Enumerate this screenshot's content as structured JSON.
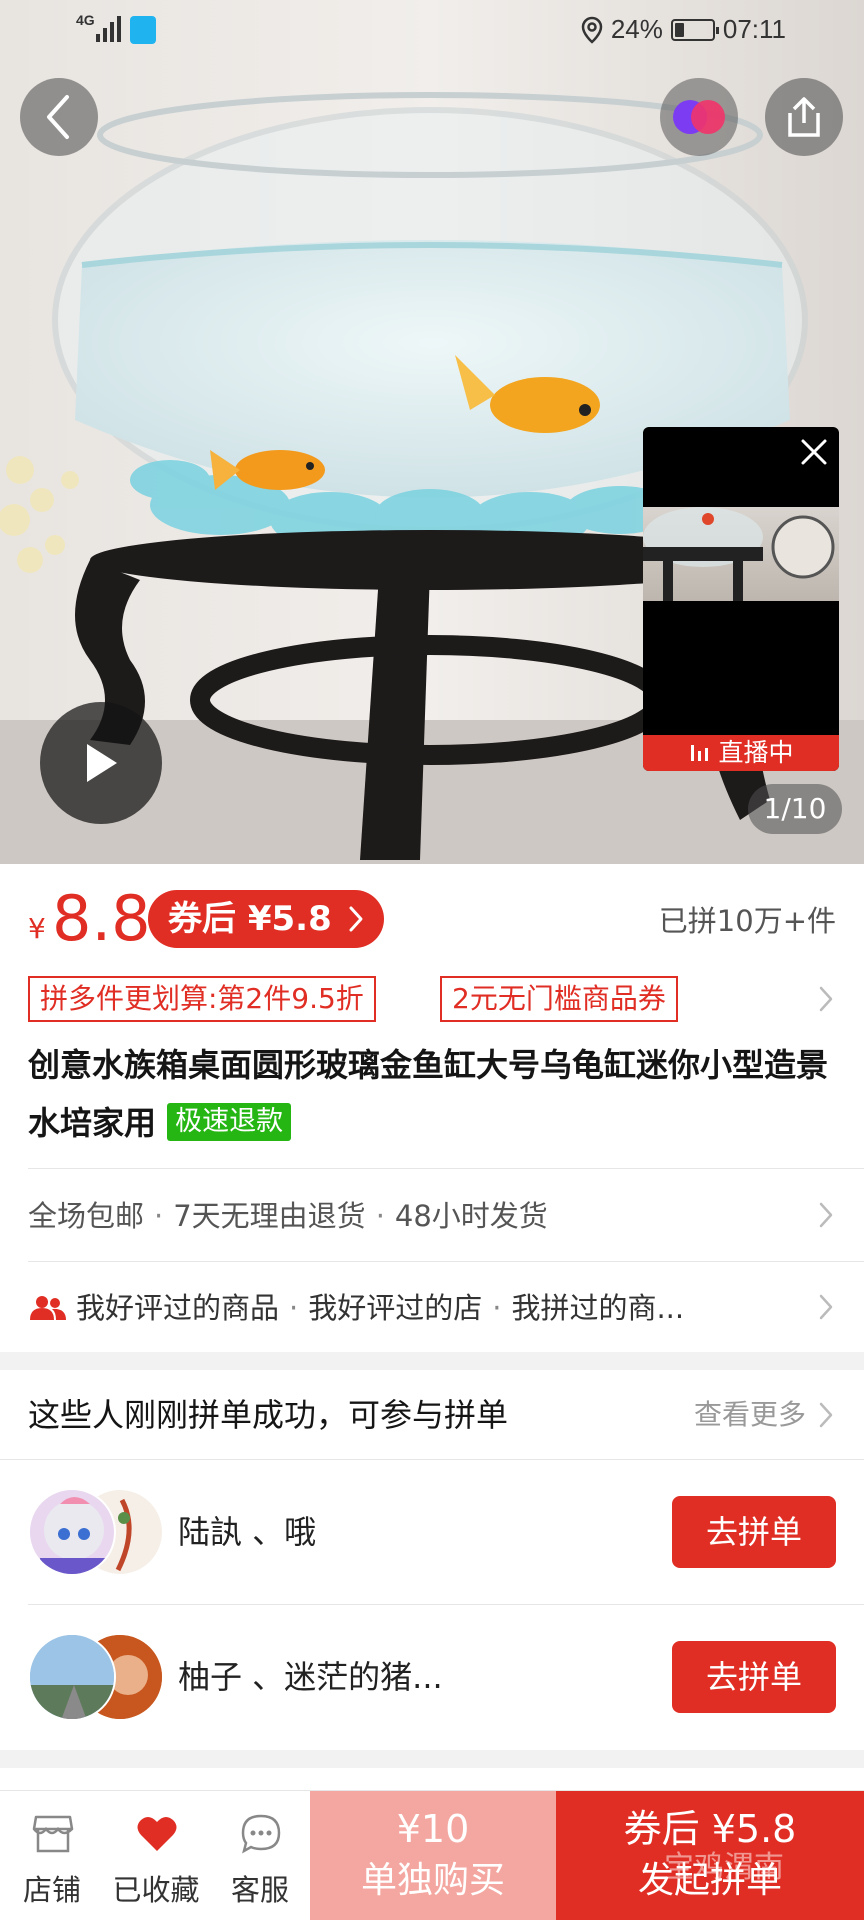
{
  "status_bar": {
    "network": "4G",
    "battery": "24%",
    "battery_level": 0.24,
    "time": "07:11"
  },
  "media": {
    "counter": "1/10",
    "live_badge": "直播中"
  },
  "price": {
    "currency": "¥",
    "value": "8.8",
    "coupon_price": "券后 ¥5.8",
    "sold": "已拼10万+件"
  },
  "promos": [
    "拼多件更划算:第2件9.5折",
    "2元无门槛商品券"
  ],
  "product": {
    "title": "创意水族箱桌面圆形玻璃金鱼缸大号乌龟缸迷你小型造景水培家用",
    "refund_tag": "极速退款"
  },
  "services": [
    "全场包邮",
    "7天无理由退货",
    "48小时发货"
  ],
  "friends": [
    "我好评过的商品",
    "我好评过的店",
    "我拼过的商..."
  ],
  "group": {
    "heading": "这些人刚刚拼单成功，可参与拼单",
    "more": "查看更多",
    "rows": [
      {
        "names": "陆訙 、哦",
        "button": "去拼单"
      },
      {
        "names": "柚子 、迷茫的猪...",
        "button": "去拼单"
      }
    ]
  },
  "bottom_bar": {
    "shop": "店铺",
    "favorited": "已收藏",
    "service": "客服",
    "single_price": "¥10",
    "single_label": "单独购买",
    "group_price": "券后 ¥5.8",
    "group_label": "发起拼单",
    "watermark": "宝鸡渭南"
  },
  "colors": {
    "brand_red": "#e02e24",
    "refund_green": "#25b614",
    "single_buy_pink": "#f4a7a0"
  }
}
